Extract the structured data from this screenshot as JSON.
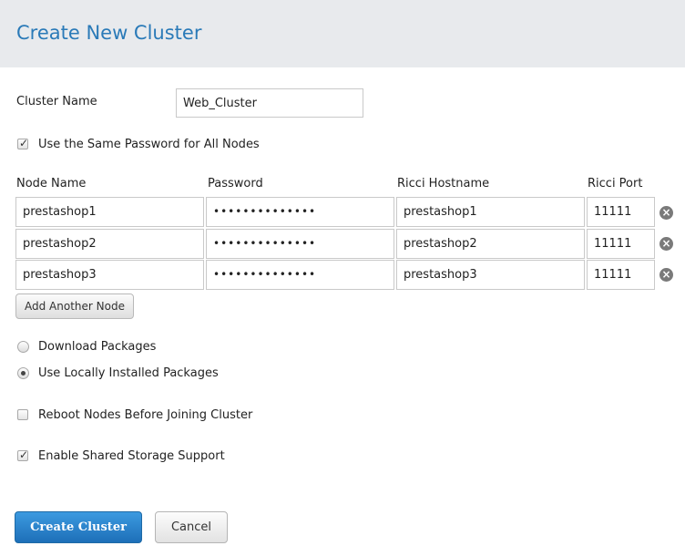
{
  "header": {
    "title": "Create New Cluster"
  },
  "cluster_name": {
    "label": "Cluster Name",
    "value": "Web_Cluster"
  },
  "same_password": {
    "label": "Use the Same Password for All Nodes",
    "checked": true
  },
  "nodes_table": {
    "headers": [
      "Node Name",
      "Password",
      "Ricci Hostname",
      "Ricci Port"
    ],
    "rows": [
      {
        "node_name": "prestashop1",
        "password": "••••••••••••••",
        "ricci_hostname": "prestashop1",
        "ricci_port": "11111",
        "remove_icon": "close-icon"
      },
      {
        "node_name": "prestashop2",
        "password": "••••••••••••••",
        "ricci_hostname": "prestashop2",
        "ricci_port": "11111",
        "remove_icon": "close-icon"
      },
      {
        "node_name": "prestashop3",
        "password": "••••••••••••••",
        "ricci_hostname": "prestashop3",
        "ricci_port": "11111",
        "remove_icon": "close-icon"
      }
    ],
    "add_node_label": "Add Another Node"
  },
  "packages": {
    "options": [
      {
        "label": "Download Packages",
        "selected": false
      },
      {
        "label": "Use Locally Installed Packages",
        "selected": true
      }
    ]
  },
  "reboot_nodes": {
    "label": "Reboot Nodes Before Joining Cluster",
    "checked": false
  },
  "shared_storage": {
    "label": "Enable Shared Storage Support",
    "checked": true
  },
  "actions": {
    "create_label": "Create Cluster",
    "cancel_label": "Cancel"
  },
  "colors": {
    "accent": "#2a7ab8",
    "primary_button": "#1d6fb8",
    "header_bg": "#e8eaed"
  }
}
